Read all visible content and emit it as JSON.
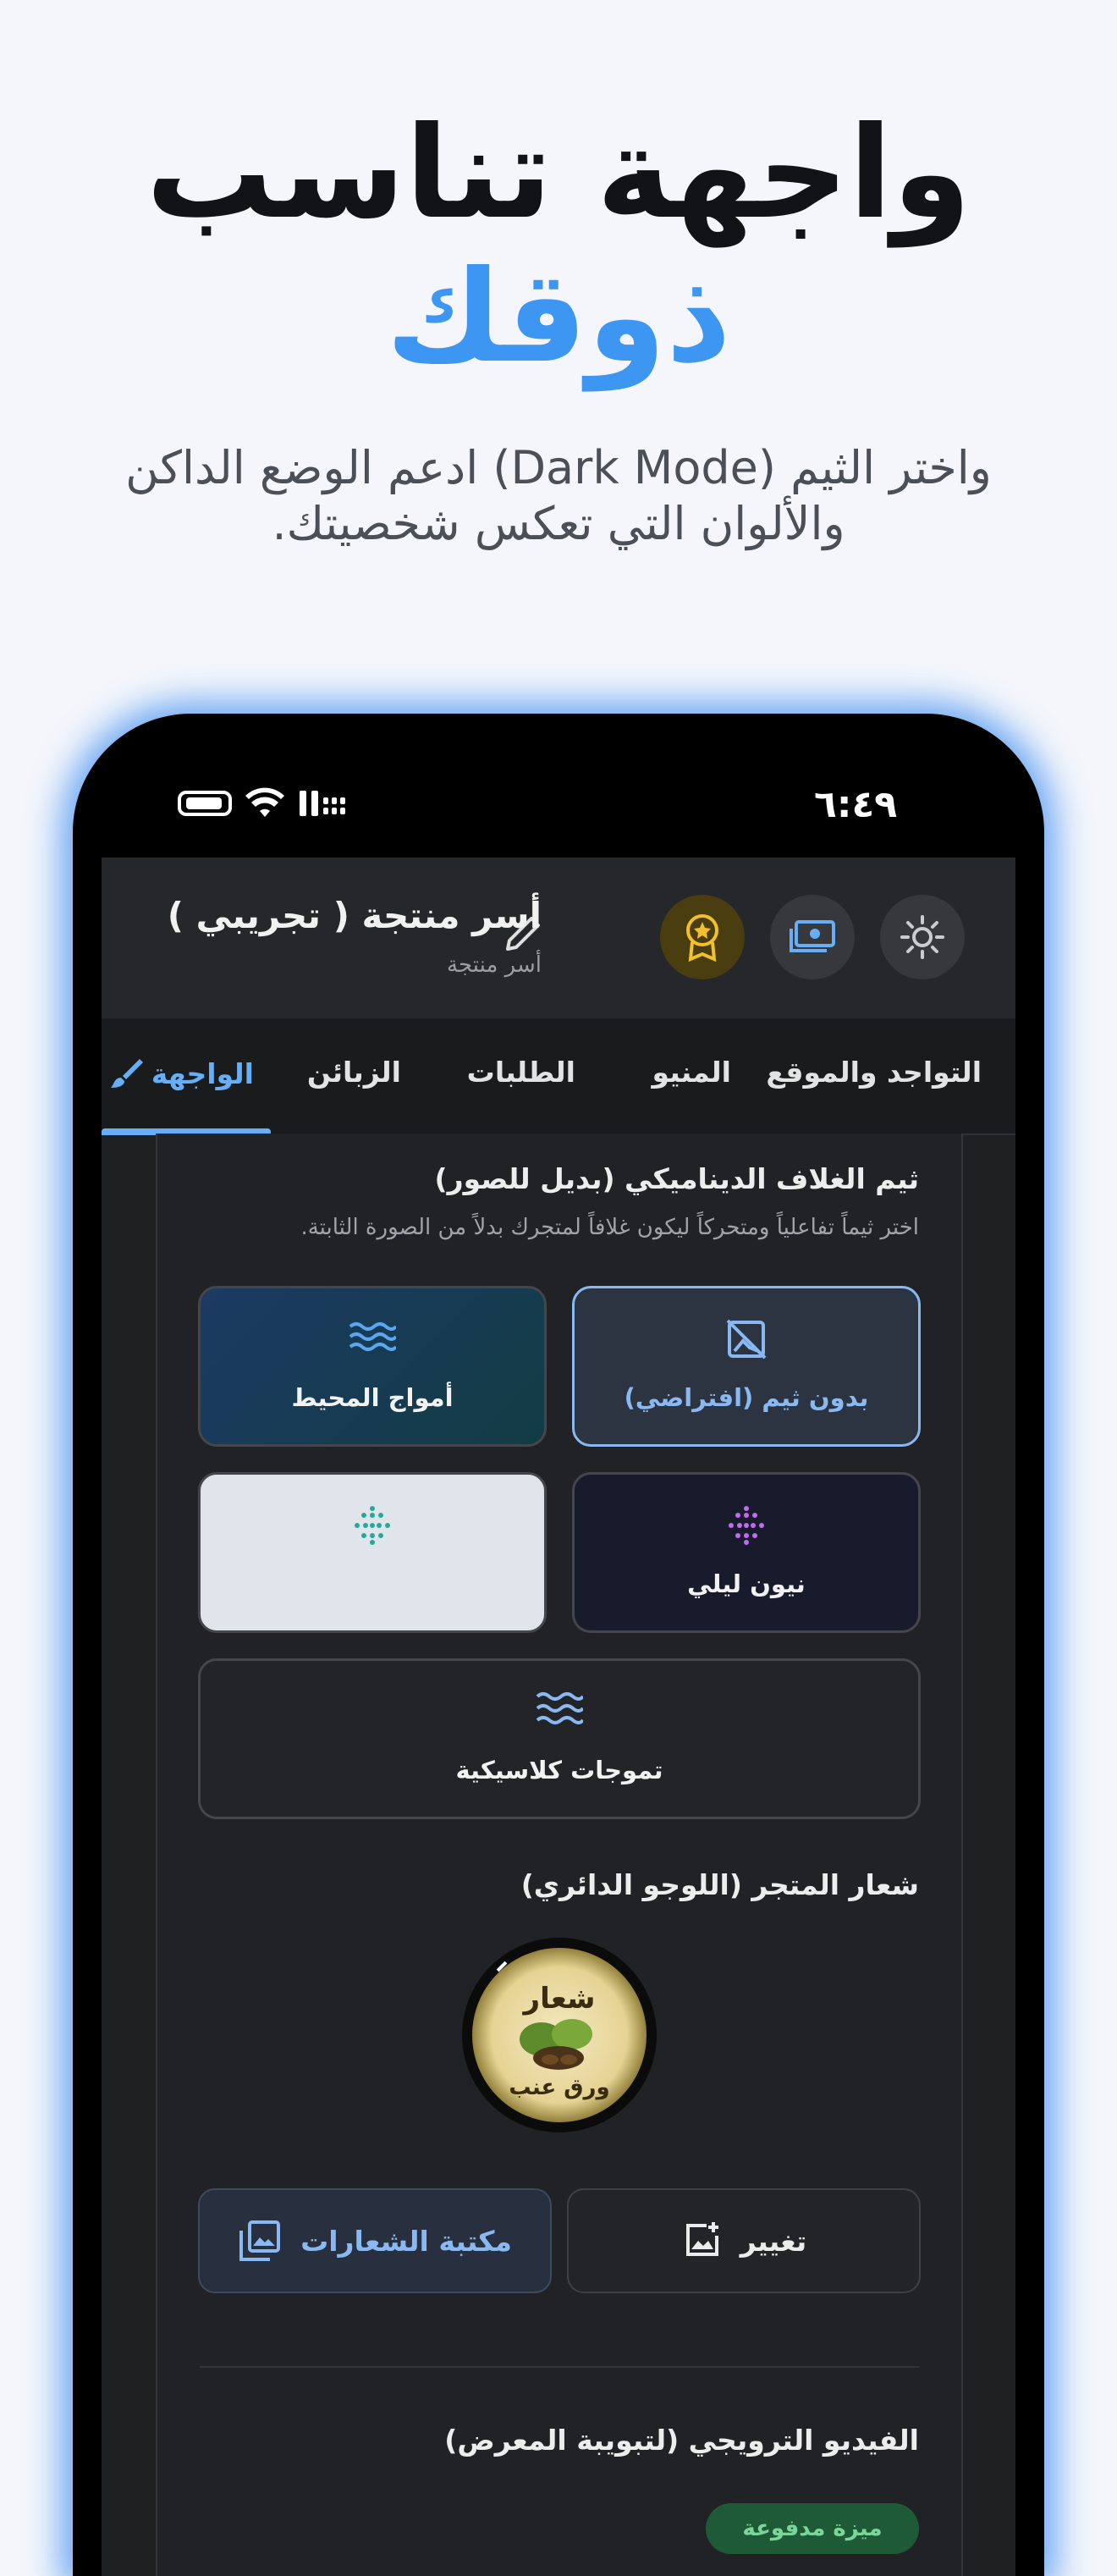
{
  "hero": {
    "title_line1": "واجهة تناسب",
    "title_line2": "ذوقك",
    "subtitle": "واختر الثيم (Dark Mode) ادعم الوضع الداكن والألوان التي تعكس شخصيتك."
  },
  "status_bar": {
    "time": "٦:٤٩"
  },
  "app_bar": {
    "store_name": "أسر منتجة ( تجريبي )",
    "store_type": "أسر منتجة",
    "icons": [
      "sun-icon",
      "money-icon",
      "award-icon",
      "pencil-icon"
    ],
    "accent_color": "#f2c02b"
  },
  "tabs": [
    {
      "label": "التواجد والموقع",
      "active": false
    },
    {
      "label": "المنيو",
      "active": false
    },
    {
      "label": "الطلبات",
      "active": false
    },
    {
      "label": "الزبائن",
      "active": false
    },
    {
      "label": "الواجهة",
      "active": true
    }
  ],
  "cover_theme": {
    "title": "ثيم الغلاف الديناميكي (بديل للصور)",
    "description": "اختر ثيماً تفاعلياً ومتحركاً ليكون غلافاً لمتجرك بدلاً من الصورة الثابتة.",
    "options": [
      {
        "label": "بدون ثيم (افتراضي)",
        "icon": "no-image-icon",
        "selected": true
      },
      {
        "label": "أمواج المحيط",
        "icon": "waves-icon",
        "selected": false
      },
      {
        "label": "نيون ليلي",
        "icon": "dots-grid-icon",
        "selected": false
      },
      {
        "label": "",
        "icon": "dots-grid-icon",
        "selected": false
      },
      {
        "label": "تموجات كلاسيكية",
        "icon": "waves-icon",
        "selected": false
      }
    ]
  },
  "logo_section": {
    "title": "شعار المتجر (اللوجو الدائري)",
    "logo_text_top": "شعار",
    "logo_text_bottom": "ورق عنب",
    "change_label": "تغيير",
    "library_label": "مكتبة الشعارات"
  },
  "video_section": {
    "title": "الفيديو الترويجي (لتبويبة المعرض)",
    "badge": "ميزة مدفوعة"
  },
  "colors": {
    "primary": "#3d96f2",
    "tab_active": "#66aef7",
    "screen_bg": "#1f2022"
  }
}
